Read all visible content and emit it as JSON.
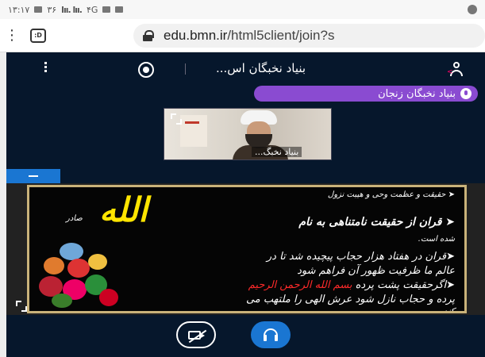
{
  "status_bar": {
    "time": "۱۳:۱۷",
    "signal_text": "۳۶",
    "bars": "lıı. lıı.",
    "network": "۴G"
  },
  "browser": {
    "url_domain": "edu.bmn.ir",
    "url_path": "/html5client/join?s",
    "tab_label": ":D"
  },
  "meeting": {
    "title": "بنیاد نخبگان اس...",
    "current_speaker": "بنیاد نخبگان زنجان",
    "video_user_name": "بنیاد نخبگ..."
  },
  "slide": {
    "line1": "حقیقت و عظمت وحی و هیبت نزول",
    "line2": "قران از حقیقت نامتناهی به نام",
    "allah": "الله",
    "saader": "صادر",
    "line3": "شده است.",
    "line4": "قران در هفتاد هزار حجاب پیچیده شد تا در",
    "line5": "عالم ما ظرفیت ظهور آن فراهم شود",
    "line6_pre": "اگرحقیقت پشت پرده",
    "line6_red": "بسم الله الرحمن الرحیم",
    "line7": "پرده و حجاب نازل شود عرش الهی را ملتهب می",
    "line8": "کند."
  },
  "colors": {
    "meeting_bg": "#06172c",
    "speaker_pill": "#8a4bd1",
    "primary_blue": "#1a76d2",
    "slide_highlight_yellow": "#ffe500",
    "slide_highlight_red": "#ff2a2a"
  }
}
